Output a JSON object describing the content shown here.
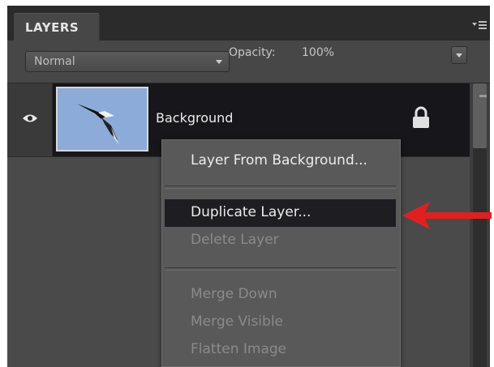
{
  "panel": {
    "title": "LAYERS",
    "blend_mode": "Normal",
    "opacity_label": "Opacity:",
    "opacity_value": "100%"
  },
  "layers": [
    {
      "name": "Background",
      "visible": true,
      "locked": true,
      "thumbnail": "bird-in-sky"
    }
  ],
  "context_menu": {
    "items": [
      {
        "label": "Layer From Background...",
        "enabled": true,
        "highlighted": false
      },
      {
        "label": "Duplicate Layer...",
        "enabled": true,
        "highlighted": true
      },
      {
        "label": "Delete Layer",
        "enabled": false,
        "highlighted": false
      },
      {
        "label": "Merge Down",
        "enabled": false,
        "highlighted": false
      },
      {
        "label": "Merge Visible",
        "enabled": false,
        "highlighted": false
      },
      {
        "label": "Flatten Image",
        "enabled": false,
        "highlighted": false
      }
    ]
  },
  "annotation": {
    "arrow_color": "#e02020",
    "points_to": "Duplicate Layer..."
  },
  "icons": [
    "eye-icon",
    "lock-icon",
    "panel-menu-icon",
    "chevron-down-icon"
  ]
}
